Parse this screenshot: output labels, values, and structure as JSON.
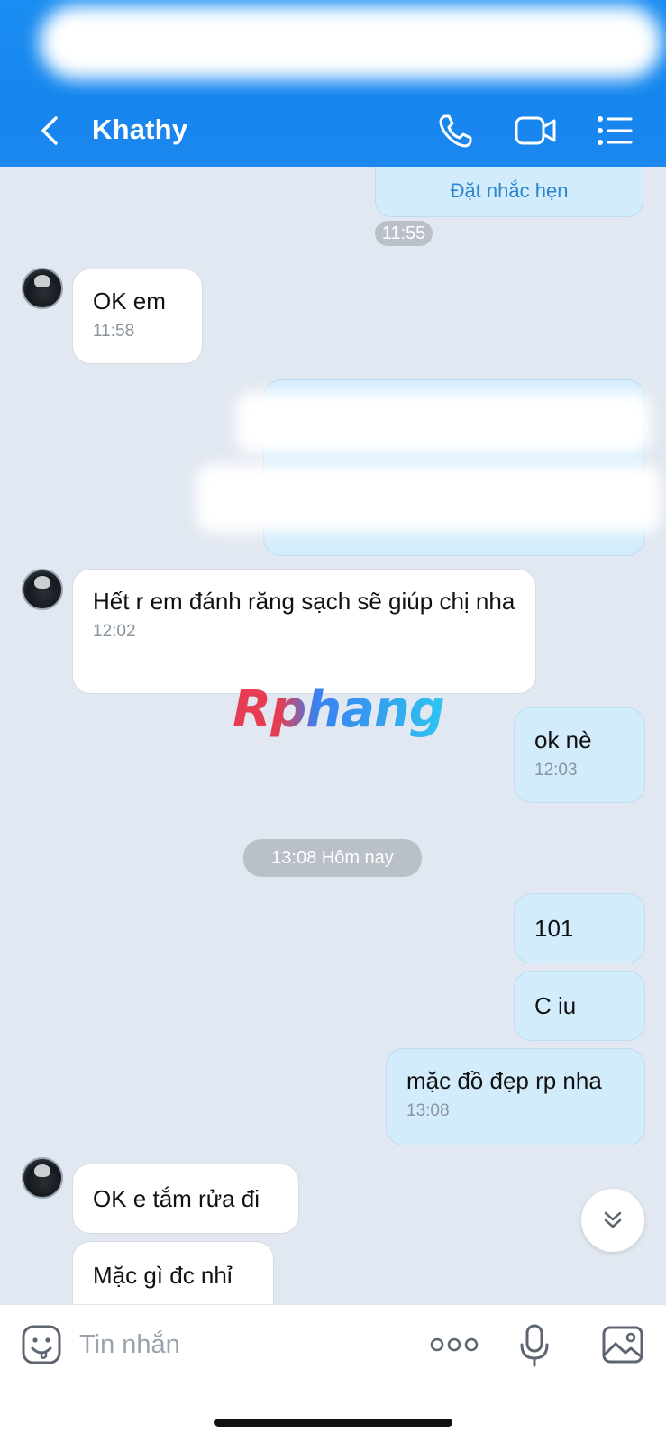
{
  "header": {
    "contact_name": "Khathy",
    "back_icon": "chevron-left-icon",
    "call_icon": "phone-icon",
    "video_icon": "video-camera-icon",
    "menu_icon": "list-menu-icon"
  },
  "colors": {
    "header_blue": "#1586ee",
    "chat_background": "#e2e8f1",
    "incoming_bubble": "#ffffff",
    "outgoing_bubble": "#d3ecfc",
    "link_text": "#2a86cf",
    "time_pill": "#b9c0c8"
  },
  "messages": {
    "reminder_action": "Đặt nhắc hẹn",
    "time_1155": "11:55",
    "m1": {
      "text": "OK em",
      "time": "11:58"
    },
    "m3": {
      "text": "Hết r em đánh răng sạch sẽ giúp chị nha",
      "time": "12:02"
    },
    "m4": {
      "text": "ok nè",
      "time": "12:03"
    },
    "separator": "13:08 Hôm nay",
    "m5": {
      "text": "101"
    },
    "m6": {
      "text": "C iu"
    },
    "m7": {
      "text": "mặc đồ đẹp rp nha",
      "time": "13:08"
    },
    "m8": {
      "text": "OK e tắm rửa đi"
    },
    "m9": {
      "text": "Mặc gì đc nhỉ"
    }
  },
  "watermark": {
    "text": "Rphang"
  },
  "input_bar": {
    "placeholder": "Tin nhắn",
    "emoji_icon": "sticker-smiley-icon",
    "more_icon": "three-dots-icon",
    "mic_icon": "microphone-icon",
    "image_icon": "image-icon"
  }
}
